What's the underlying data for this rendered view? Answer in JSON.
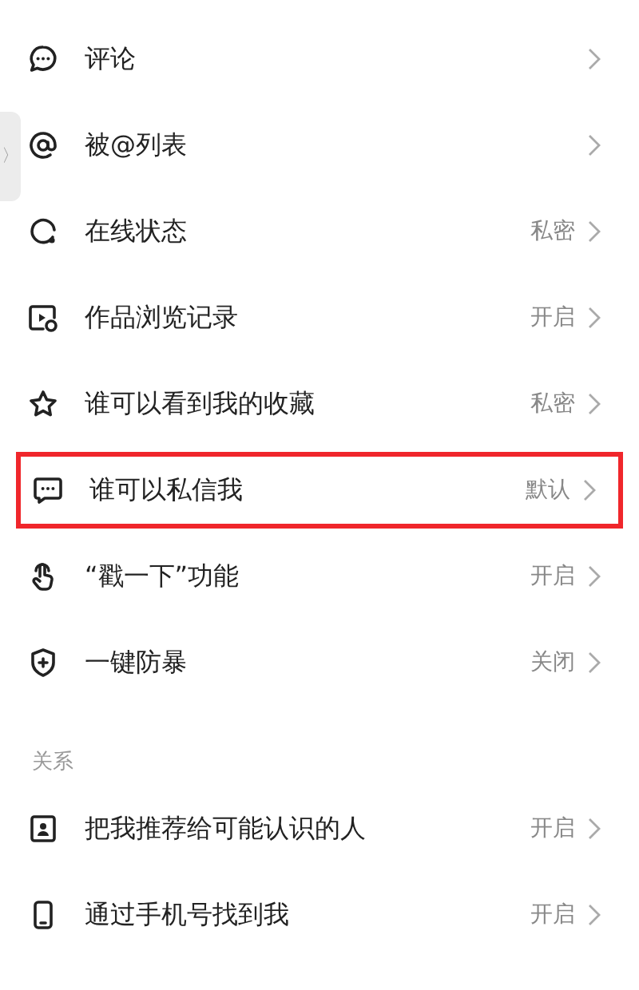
{
  "side_handle": {
    "label": "〉"
  },
  "privacy_items": [
    {
      "label": "评论",
      "highlighted": false
    },
    {
      "label": "被@列表",
      "highlighted": false
    },
    {
      "label": "在线状态",
      "value": "私密",
      "highlighted": false
    },
    {
      "label": "作品浏览记录",
      "value": "开启",
      "highlighted": false
    },
    {
      "label": "谁可以看到我的收藏",
      "value": "私密",
      "highlighted": false
    },
    {
      "label": "谁可以私信我",
      "value": "默认",
      "highlighted": true
    },
    {
      "label": "“戳一下”功能",
      "value": "开启",
      "highlighted": false
    },
    {
      "label": "一键防暴",
      "value": "关闭",
      "highlighted": false
    }
  ],
  "relations_section": {
    "title": "关系",
    "items": [
      {
        "label": "把我推荐给可能认识的人",
        "value": "开启",
        "highlighted": false
      },
      {
        "label": "通过手机号找到我",
        "value": "开启",
        "highlighted": false
      }
    ]
  }
}
